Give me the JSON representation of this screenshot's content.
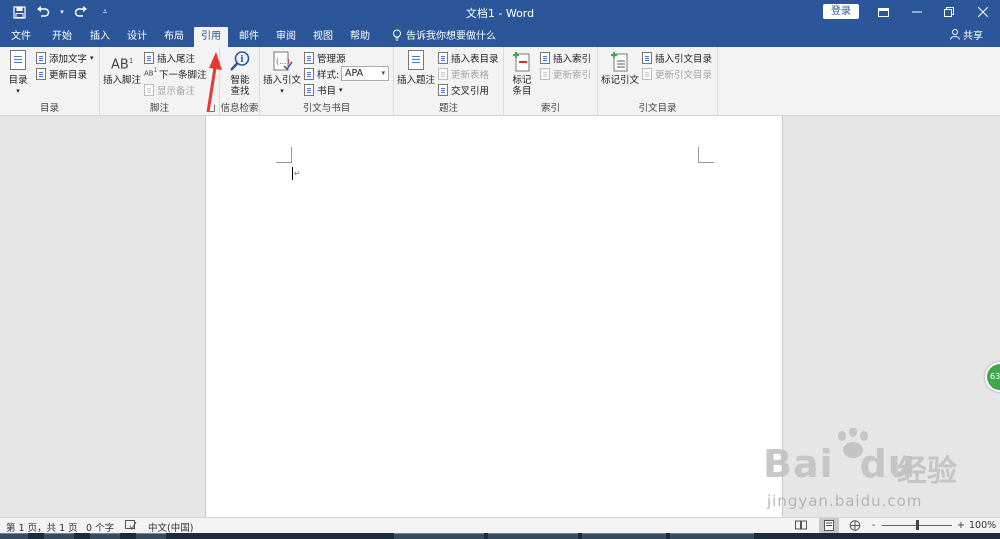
{
  "app": {
    "title": "文档1 - Word",
    "login": "登录",
    "tell_me": "告诉我你想要做什么",
    "share": "共享"
  },
  "tabs": [
    "文件",
    "开始",
    "插入",
    "设计",
    "布局",
    "引用",
    "邮件",
    "审阅",
    "视图",
    "帮助"
  ],
  "active_tab": "引用",
  "ribbon": {
    "toc": {
      "label": "目录",
      "toc_button": "目录",
      "add_text": "添加文字",
      "update_toc": "更新目录"
    },
    "footnotes": {
      "label": "脚注",
      "insert_footnote": "插入脚注",
      "footnote_icon_text": "AB",
      "insert_endnote": "插入尾注",
      "next_footnote": "下一条脚注",
      "show_notes": "显示备注"
    },
    "research": {
      "label": "信息检索",
      "smart_lookup": "智能",
      "smart_lookup_2": "查找"
    },
    "citations": {
      "label": "引文与书目",
      "insert_citation": "插入引文",
      "manage_sources": "管理源",
      "style_label": "样式:",
      "style_value": "APA",
      "bibliography": "书目"
    },
    "captions": {
      "label": "题注",
      "insert_caption": "插入题注",
      "insert_table_of_figures": "插入表目录",
      "update_table": "更新表格",
      "cross_reference": "交叉引用"
    },
    "index": {
      "label": "索引",
      "mark_entry": "标记",
      "mark_entry_2": "条目",
      "insert_index": "插入索引",
      "update_index": "更新索引"
    },
    "toa": {
      "label": "引文目录",
      "mark_citation": "标记引文",
      "insert_toa": "插入引文目录",
      "update_toa": "更新引文目录"
    }
  },
  "status": {
    "page": "第 1 页，共 1 页",
    "words": "0 个字",
    "language": "中文(中国)",
    "zoom_minus": "-",
    "zoom_plus": "+",
    "zoom_level": "100%",
    "zoom_fraction": 0.5
  },
  "watermark": {
    "brand": "Bai",
    "brand2": "du",
    "cn": "经验",
    "url": "jingyan.baidu.com"
  },
  "side_badge": "63",
  "colors": {
    "word_blue": "#2b579a",
    "ribbon_bg": "#f3f3f3",
    "annotation_arrow": "#e53935"
  }
}
